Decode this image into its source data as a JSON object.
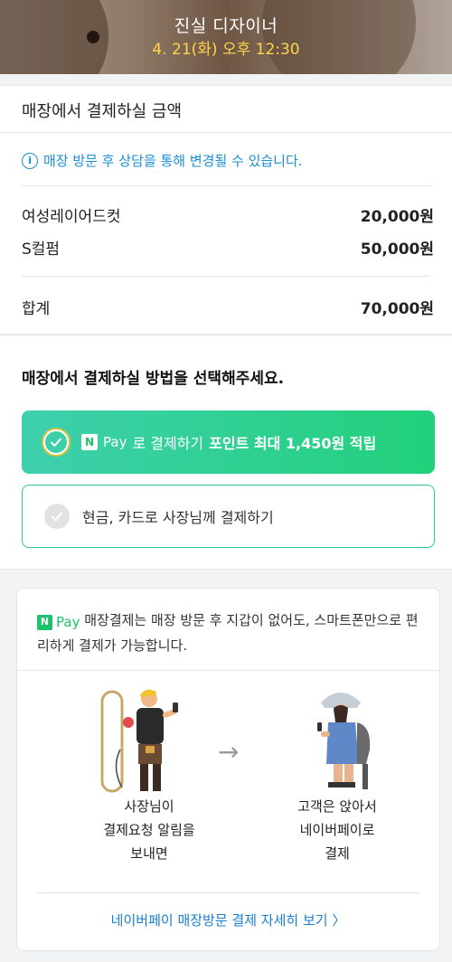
{
  "header": {
    "designer": "진실 디자이너",
    "datetime": "4. 21(화) 오후 12:30"
  },
  "amount": {
    "title": "매장에서 결제하실 금액",
    "notice": "매장 방문 후 상담을 통해 변경될 수 있습니다.",
    "items": [
      {
        "name": "여성레이어드컷",
        "price": "20,000원"
      },
      {
        "name": "S컬펌",
        "price": "50,000원"
      }
    ],
    "total_label": "합계",
    "total_price": "70,000원"
  },
  "method": {
    "title": "매장에서 결제하실 방법을 선택해주세요.",
    "npay_badge": "N",
    "npay_word": "Pay",
    "npay_text": "로 결제하기",
    "npay_point": "포인트 최대 1,450원 적립",
    "cash_text": "현금, 카드로 사장님께 결제하기",
    "selected": "npay"
  },
  "info": {
    "npay_badge": "N",
    "npay_word": "Pay",
    "description": "매장결제는 매장 방문 후 지갑이 없어도, 스마트폰만으로 편리하게 결제가 가능합니다.",
    "owner_caption": [
      "사장님이",
      "결제요청 알림을",
      "보내면"
    ],
    "customer_caption": [
      "고객은 앉아서",
      "네이버페이로",
      "결제"
    ],
    "arrow": "→",
    "more_link": "네이버페이 매장방문 결제 자세히 보기 〉"
  },
  "colors": {
    "npay_green": "#1fc16c",
    "link_blue": "#1a7fd0",
    "notice_blue": "#1a8fd6",
    "datetime_yellow": "#ffd54a"
  }
}
